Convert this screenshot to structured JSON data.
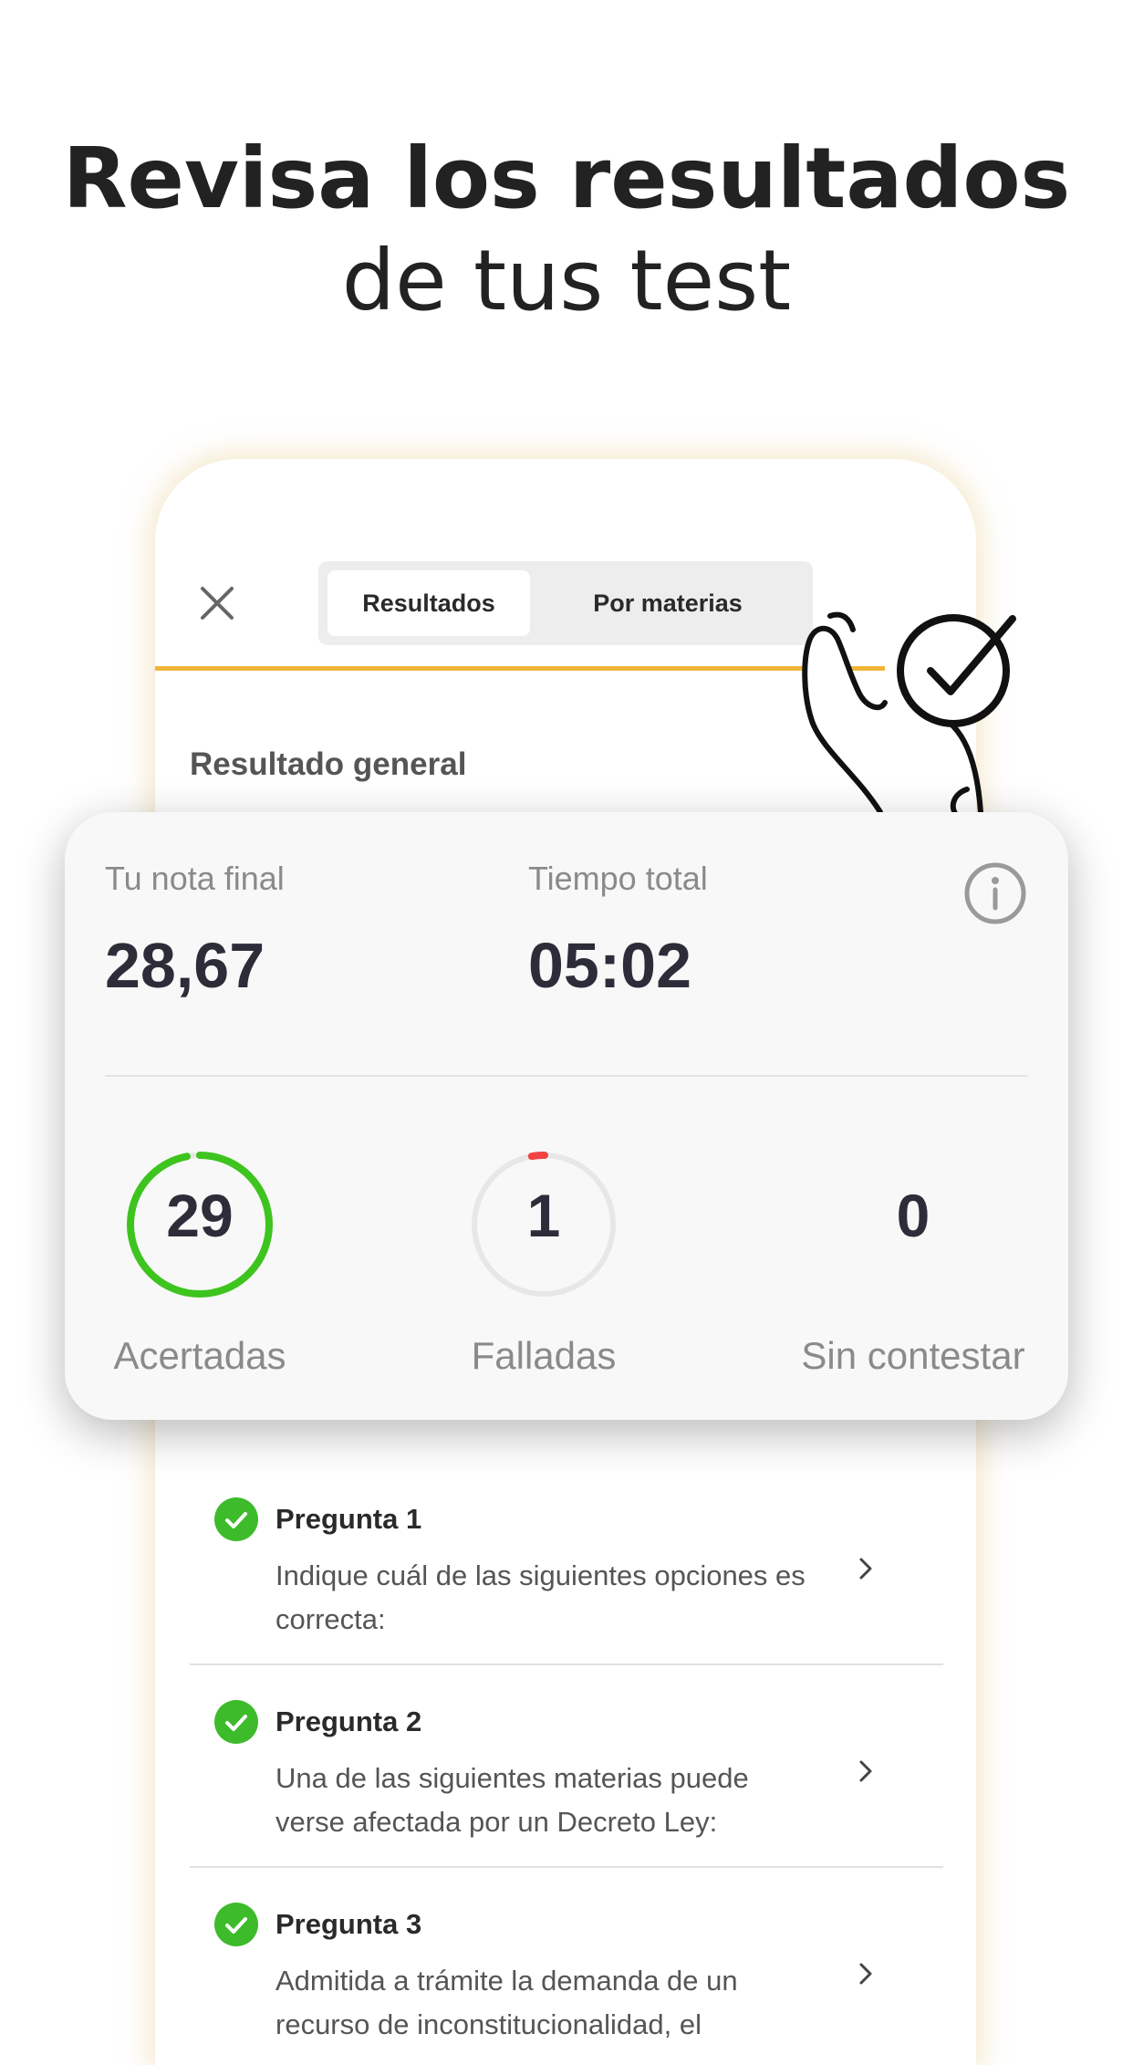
{
  "headline": {
    "line1": "Revisa los resultados",
    "line2": "de tus test"
  },
  "app": {
    "tabs": [
      {
        "label": "Resultados",
        "active": true
      },
      {
        "label": "Por materias",
        "active": false
      }
    ],
    "section_title": "Resultado general",
    "accent_color": "#f0b637"
  },
  "summary": {
    "final_grade_label": "Tu nota final",
    "final_grade_value": "28,67",
    "total_time_label": "Tiempo total",
    "total_time_value": "05:02",
    "correct": {
      "value": "29",
      "label": "Acertadas",
      "color": "#3dc41e",
      "fraction": 0.97
    },
    "failed": {
      "value": "1",
      "label": "Falladas",
      "color": "#f04444",
      "fraction": 0.03
    },
    "unanswered": {
      "value": "0",
      "label": "Sin contestar"
    }
  },
  "questions": [
    {
      "title": "Pregunta 1",
      "text": "Indique cuál de las siguientes opciones es correcta:",
      "status": "correct"
    },
    {
      "title": "Pregunta 2",
      "text": "Una de las siguientes materias puede verse afectada por un Decreto Ley:",
      "status": "correct"
    },
    {
      "title": "Pregunta 3",
      "text": "Admitida a trámite la demanda de un recurso de inconstitucionalidad, el",
      "status": "correct"
    }
  ]
}
